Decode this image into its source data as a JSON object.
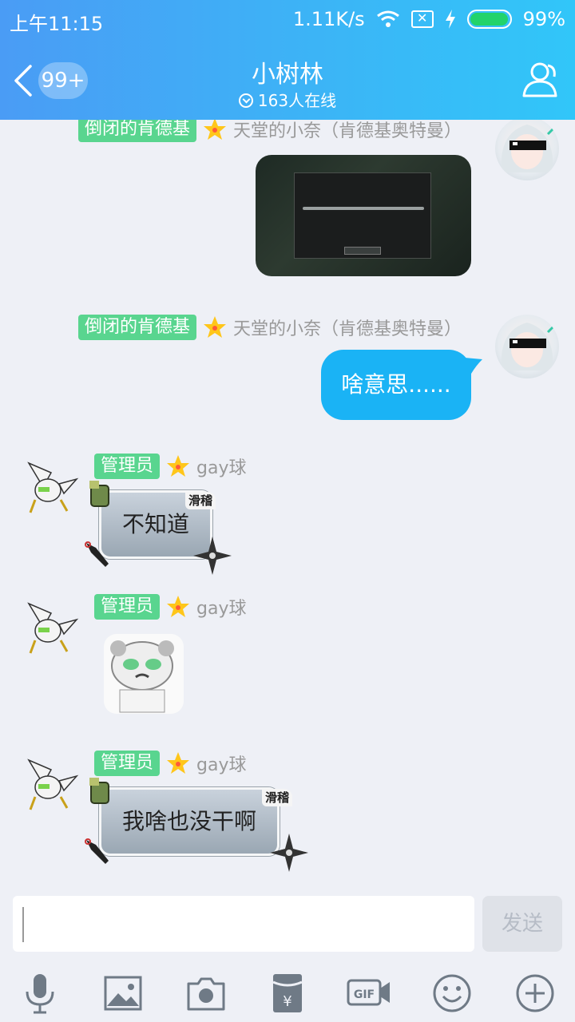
{
  "status_bar": {
    "time": "上午11:15",
    "net_speed": "1.11K/s",
    "battery_pct": "99%",
    "battery_level": 0.99
  },
  "header": {
    "back_badge": "99+",
    "title": "小树林",
    "online": "163人在线"
  },
  "messages": {
    "m1": {
      "tag": "倒闭的肯德基",
      "sender": "天堂的小奈（肯德基奥特曼）"
    },
    "m2": {
      "tag": "倒闭的肯德基",
      "sender": "天堂的小奈（肯德基奥特曼）",
      "text": "啥意思......"
    },
    "m3": {
      "tag": "管理员",
      "sender": "gay球",
      "text": "不知道",
      "bubble_label": "滑稽"
    },
    "m4": {
      "tag": "管理员",
      "sender": "gay球"
    },
    "m5": {
      "tag": "管理员",
      "sender": "gay球",
      "text": "我啥也没干啊",
      "bubble_label": "滑稽"
    }
  },
  "composer": {
    "placeholder": "",
    "send_label": "发送"
  },
  "colors": {
    "header_start": "#4a9cf5",
    "header_end": "#31c6f9",
    "tag": "#59d58f",
    "bubble_blue": "#1ab3f5",
    "background": "#eef0f6"
  },
  "icons": [
    "back-icon",
    "wifi-icon",
    "sim-icon",
    "bolt-icon",
    "members-icon",
    "star-icon",
    "mic-icon",
    "image-icon",
    "camera-icon",
    "red-packet-icon",
    "gif-icon",
    "emoji-icon",
    "plus-icon"
  ]
}
